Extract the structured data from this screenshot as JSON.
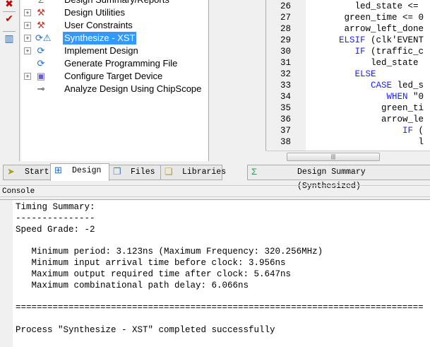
{
  "toolbar": {
    "icons": [
      "remove-icon",
      "check-icon",
      "window-icon"
    ]
  },
  "tree": {
    "items": [
      {
        "label": "Design Summary/Reports",
        "icon": "sigma",
        "expander": false
      },
      {
        "label": "Design Utilities",
        "icon": "tools",
        "expander": true
      },
      {
        "label": "User Constraints",
        "icon": "tools",
        "expander": true
      },
      {
        "label": "Synthesize - XST",
        "icon": "process-warning",
        "expander": true,
        "selected": true
      },
      {
        "label": "Implement Design",
        "icon": "process",
        "expander": true
      },
      {
        "label": "Generate Programming File",
        "icon": "process",
        "expander": false
      },
      {
        "label": "Configure Target Device",
        "icon": "device",
        "expander": true
      },
      {
        "label": "Analyze Design Using ChipScope",
        "icon": "probe",
        "expander": false
      }
    ]
  },
  "editor": {
    "lines": [
      {
        "n": "26",
        "pre": "         ",
        "kw": "",
        "rest": "led_state <="
      },
      {
        "n": "27",
        "pre": "       ",
        "kw": "",
        "rest": "green_time <= 0"
      },
      {
        "n": "28",
        "pre": "       ",
        "kw": "",
        "rest": "arrow_left_done"
      },
      {
        "n": "29",
        "pre": "      ",
        "kw": "ELSIF",
        "rest": " (clk'EVENT"
      },
      {
        "n": "30",
        "pre": "         ",
        "kw": "IF",
        "rest": " (traffic_c"
      },
      {
        "n": "31",
        "pre": "            ",
        "kw": "",
        "rest": "led_state"
      },
      {
        "n": "32",
        "pre": "         ",
        "kw": "ELSE",
        "rest": ""
      },
      {
        "n": "33",
        "pre": "            ",
        "kw": "CASE",
        "rest": " led_s"
      },
      {
        "n": "34",
        "pre": "               ",
        "kw": "WHEN",
        "rest": " \"0"
      },
      {
        "n": "35",
        "pre": "              ",
        "kw": "",
        "rest": "green_ti"
      },
      {
        "n": "36",
        "pre": "              ",
        "kw": "",
        "rest": "arrow_le"
      },
      {
        "n": "37",
        "pre": "                  ",
        "kw": "IF",
        "rest": " ("
      },
      {
        "n": "38",
        "pre": "                     ",
        "kw": "",
        "rest": "l"
      }
    ]
  },
  "tabs": [
    {
      "label": "Start",
      "icon": "start-icon"
    },
    {
      "label": "Design",
      "icon": "design-icon",
      "active": true
    },
    {
      "label": "Files",
      "icon": "files-icon"
    },
    {
      "label": "Libraries",
      "icon": "libraries-icon"
    }
  ],
  "doc_tab": {
    "label": "Design Summary (Synthesized)"
  },
  "console": {
    "title": "Console",
    "lines": [
      "Timing Summary:",
      "---------------",
      "Speed Grade: -2",
      "",
      "   Minimum period: 3.123ns (Maximum Frequency: 320.256MHz)",
      "   Minimum input arrival time before clock: 3.956ns",
      "   Maximum output required time after clock: 5.647ns",
      "   Maximum combinational path delay: 6.066ns",
      "",
      "=============================================================================",
      "",
      "Process \"Synthesize - XST\" completed successfully"
    ]
  }
}
